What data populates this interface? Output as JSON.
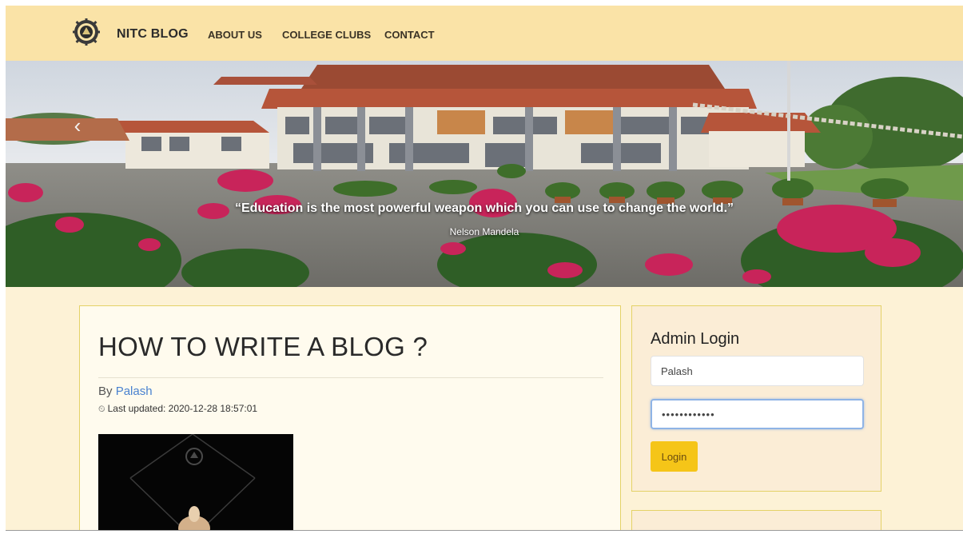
{
  "nav": {
    "brand": "NITC BLOG",
    "links": [
      "ABOUT US",
      "COLLEGE CLUBS",
      "CONTACT"
    ]
  },
  "hero": {
    "quote": "“Education is the most powerful weapon which you can use to change the world.”",
    "author": "Nelson Mandela",
    "prev_icon": "‹"
  },
  "post": {
    "title": "HOW TO WRITE A BLOG ?",
    "by_label": "By",
    "author": "Palash",
    "updated_label": "Last updated: 2020-12-28 18:57:01",
    "clock_icon": "⏲"
  },
  "login": {
    "title": "Admin Login",
    "username_value": "Palash",
    "password_value": "••••••••••••",
    "button_label": "Login"
  },
  "colors": {
    "navbar_bg": "#fae3a7",
    "content_bg": "#fdf2d6",
    "card_border": "#e4d267",
    "login_button": "#f5c518",
    "author_link": "#4a82d0"
  }
}
